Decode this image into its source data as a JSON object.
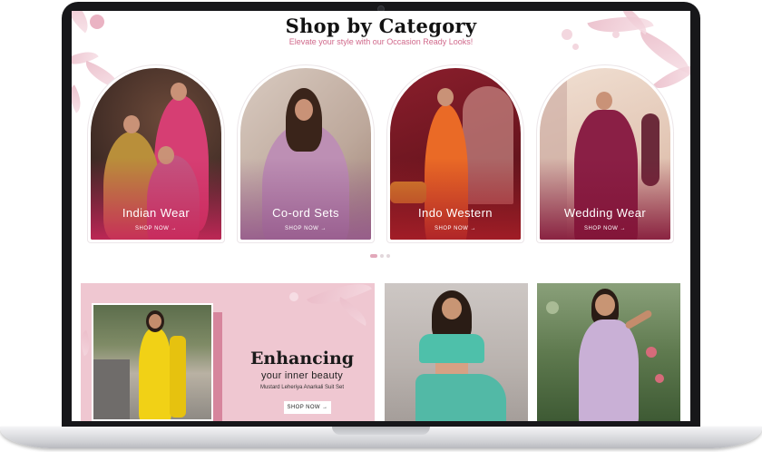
{
  "header": {
    "title": "Shop by Category",
    "subtitle": "Elevate your style with our Occasion Ready Looks!"
  },
  "categories": [
    {
      "label": "Indian Wear",
      "shop": "SHOP NOW →"
    },
    {
      "label": "Co-ord Sets",
      "shop": "SHOP NOW →"
    },
    {
      "label": "Indo Western",
      "shop": "SHOP NOW →"
    },
    {
      "label": "Wedding Wear",
      "shop": "SHOP NOW →"
    }
  ],
  "carousel": {
    "pages": 3,
    "active": 1
  },
  "promo": {
    "heading": "Enhancing",
    "subheading": "your inner beauty",
    "product": "Mustard Leheriya Anarkali Suit Set",
    "button": "SHOP NOW →"
  },
  "colors": {
    "accent_pink": "#d0698b",
    "promo_bg": "#efc7d1",
    "bezel": "#17171a"
  }
}
